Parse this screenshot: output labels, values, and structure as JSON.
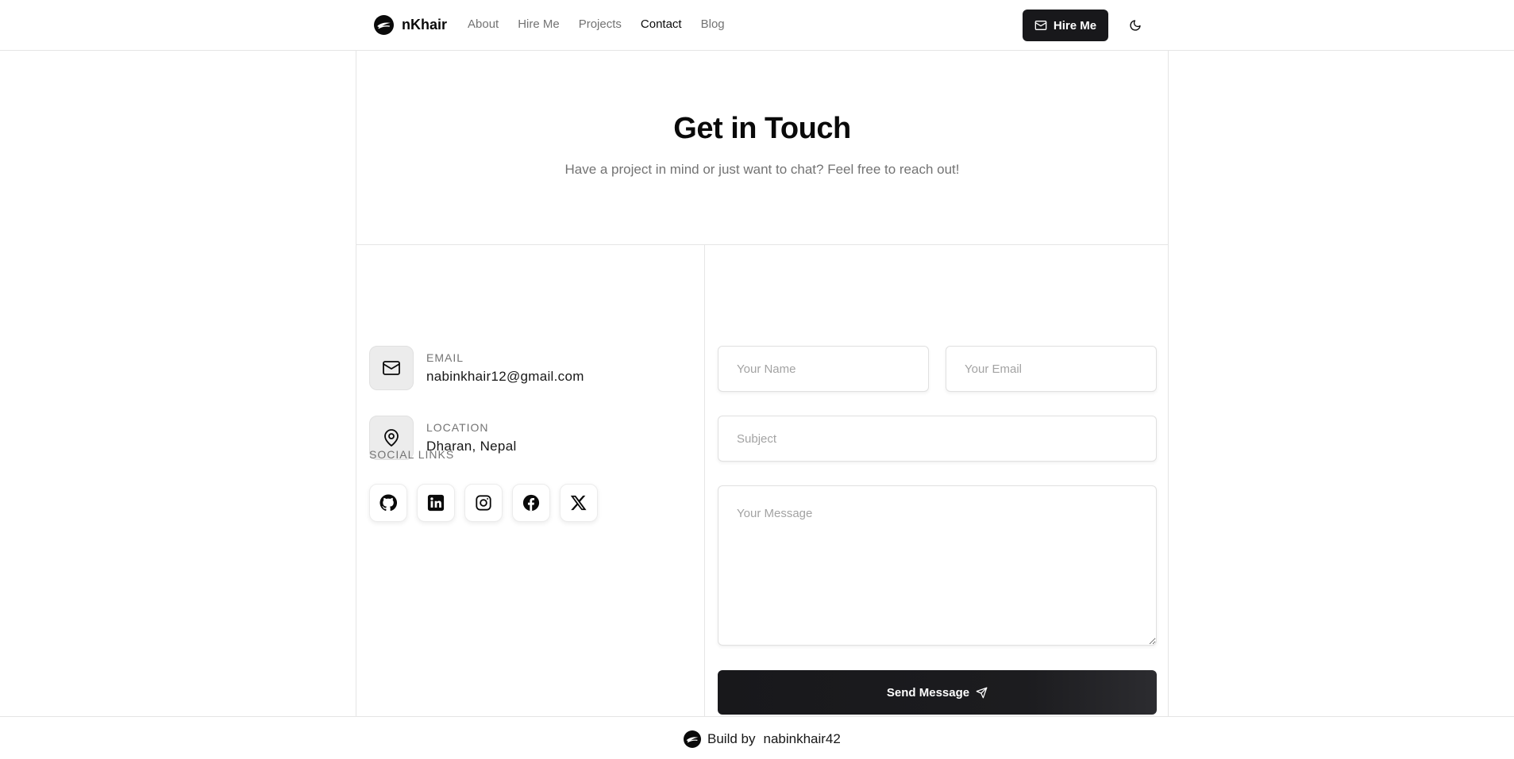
{
  "header": {
    "brand_name": "nKhair",
    "brand_logo_icon": "swoosh-logo-icon",
    "nav": [
      {
        "label": "About",
        "active": false
      },
      {
        "label": "Hire Me",
        "active": false
      },
      {
        "label": "Projects",
        "active": false
      },
      {
        "label": "Contact",
        "active": true
      },
      {
        "label": "Blog",
        "active": false
      }
    ],
    "hire_button": {
      "label": "Hire Me",
      "icon": "mail-icon"
    },
    "theme_toggle_icon": "moon-icon"
  },
  "hero": {
    "title": "Get in Touch",
    "subtitle": "Have a project in mind or just want to chat? Feel free to reach out!"
  },
  "contact_info": {
    "email": {
      "label": "EMAIL",
      "value": "nabinkhair12@gmail.com",
      "icon": "mail-icon"
    },
    "location": {
      "label": "LOCATION",
      "value": "Dharan, Nepal",
      "icon": "map-pin-icon"
    }
  },
  "social": {
    "title": "SOCIAL LINKS",
    "links": [
      {
        "icon": "github-icon"
      },
      {
        "icon": "linkedin-icon"
      },
      {
        "icon": "instagram-icon"
      },
      {
        "icon": "facebook-icon"
      },
      {
        "icon": "x-twitter-icon"
      }
    ]
  },
  "form": {
    "name": {
      "placeholder": "Your Name",
      "value": ""
    },
    "email": {
      "placeholder": "Your Email",
      "value": ""
    },
    "subject": {
      "placeholder": "Subject",
      "value": ""
    },
    "message": {
      "placeholder": "Your Message",
      "value": ""
    },
    "submit_label": "Send Message",
    "submit_icon": "send-icon"
  },
  "footer": {
    "prefix": "Build by",
    "author": "nabinkhair42"
  },
  "colors": {
    "primary": "#18181b",
    "muted_text": "#737373",
    "border": "#e5e5e5"
  }
}
